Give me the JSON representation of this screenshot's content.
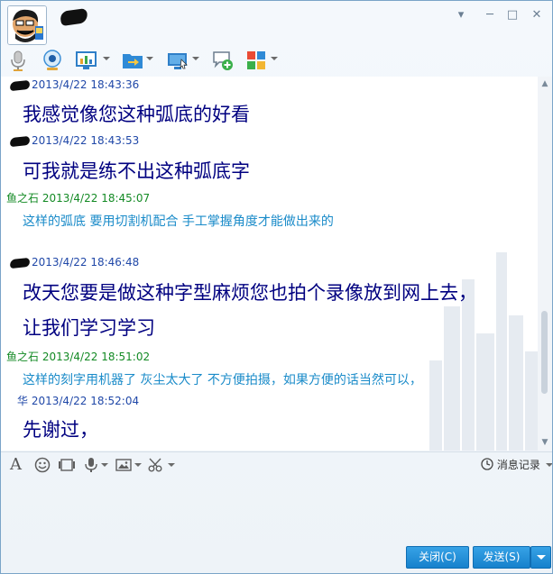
{
  "titlebar": {
    "minimize_glyph": "─",
    "maximize_glyph": "□",
    "close_glyph": "✕",
    "menu_glyph": "▾"
  },
  "messages": [
    {
      "sender": "",
      "time": "2013/4/22 18:43:36",
      "text": "我感觉像您这种弧底的好看",
      "style": "big"
    },
    {
      "sender": "",
      "time": "2013/4/22 18:43:53",
      "text": "可我就是练不出这种弧底字",
      "style": "big"
    },
    {
      "sender": "鱼之石",
      "time": "2013/4/22 18:45:07",
      "text": "这样的弧底 要用切割机配合 手工掌握角度才能做出来的",
      "style": "small"
    },
    {
      "sender": "",
      "time": "2013/4/22 18:46:48",
      "text": "改天您要是做这种字型麻烦您也拍个录像放到网上去，",
      "text2": "让我们学习学习",
      "style": "big"
    },
    {
      "sender": "鱼之石",
      "time": "2013/4/22 18:51:02",
      "text": "这样的刻字用机器了 灰尘太大了 不方便拍摄，如果方便的话当然可以，",
      "style": "small"
    },
    {
      "sender": "华",
      "time": "2013/4/22 18:52:04",
      "text": "先谢过，",
      "style": "big"
    }
  ],
  "input_toolbar": {
    "font_glyph": "A",
    "history_label": "消息记录"
  },
  "buttons": {
    "close_label": "关闭(C)",
    "send_label": "发送(S)"
  },
  "colors": {
    "accent": "#1681cc",
    "sender_green": "#138a24",
    "sender_blue": "#2048a8",
    "big_text": "#000080",
    "small_text": "#1a8bc9"
  },
  "icons": [
    "voice-call-icon",
    "video-call-icon",
    "remote-desktop-icon",
    "file-transfer-icon",
    "screen-share-icon",
    "invite-contact-icon",
    "apps-grid-icon",
    "font-icon",
    "emoji-icon",
    "screenshot-icon",
    "voice-message-icon",
    "image-icon",
    "scissors-icon",
    "history-clock-icon"
  ]
}
